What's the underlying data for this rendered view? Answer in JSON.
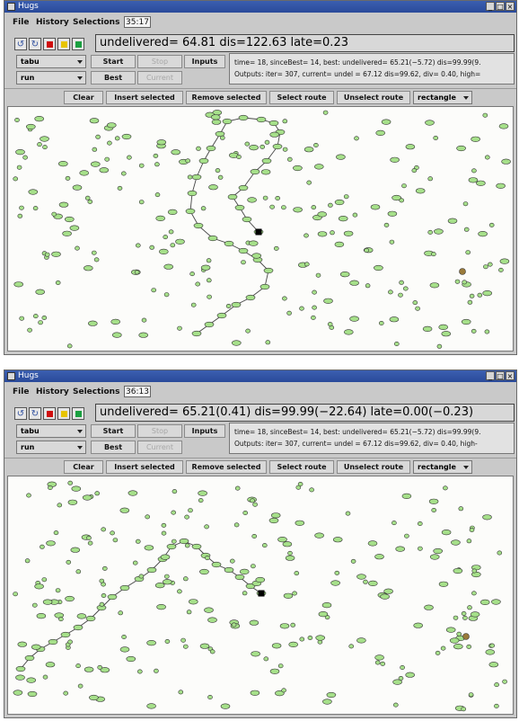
{
  "windows": [
    {
      "title": "Hugs",
      "menu": [
        "File",
        "History",
        "Selections"
      ],
      "clock": "35:17",
      "status": "undelivered= 64.81 dis=122.63 late=0.23",
      "algo": "tabu",
      "mode": "run",
      "buttons": {
        "start": "Start",
        "stop": "Stop",
        "inputs": "Inputs",
        "best": "Best",
        "current": "Current"
      },
      "outputs": [
        "time= 18, sinceBest= 14, best: undelivered= 65.21(−5.72) dis=99.99(9.",
        "Outputs: iter= 307, current= undel = 67.12 dis=99.62, div= 0.40, high="
      ],
      "tools": [
        "Clear",
        "Insert selected",
        "Remove selected",
        "Select route",
        "Unselect route"
      ],
      "shape": "rectangle"
    },
    {
      "title": "Hugs",
      "menu": [
        "File",
        "History",
        "Selections"
      ],
      "clock": "36:13",
      "status": "undelivered= 65.21(0.41) dis=99.99(−22.64) late=0.00(−0.23)",
      "algo": "tabu",
      "mode": "run",
      "buttons": {
        "start": "Start",
        "stop": "Stop",
        "inputs": "Inputs",
        "best": "Best",
        "current": "Current"
      },
      "outputs": [
        "time= 18, sinceBest= 14, best: undelivered= 65.21(−5.72) dis=99.99(9.",
        "Outputs: iter= 307, current= undel = 67.12 dis=99.62, div= 0.40, high-"
      ],
      "tools": [
        "Clear",
        "Insert selected",
        "Remove selected",
        "Select route",
        "Unselect route"
      ],
      "shape": "rectangle"
    }
  ],
  "colors": {
    "node_fill": "#a6e08a",
    "node_stroke": "#333333",
    "depot": "#000000",
    "vehicle": "#9a7a3a",
    "title_bar": "#2a4a9a"
  },
  "icons": [
    "undo-icon",
    "redo-icon",
    "stop-icon",
    "pause-icon",
    "play-icon"
  ]
}
